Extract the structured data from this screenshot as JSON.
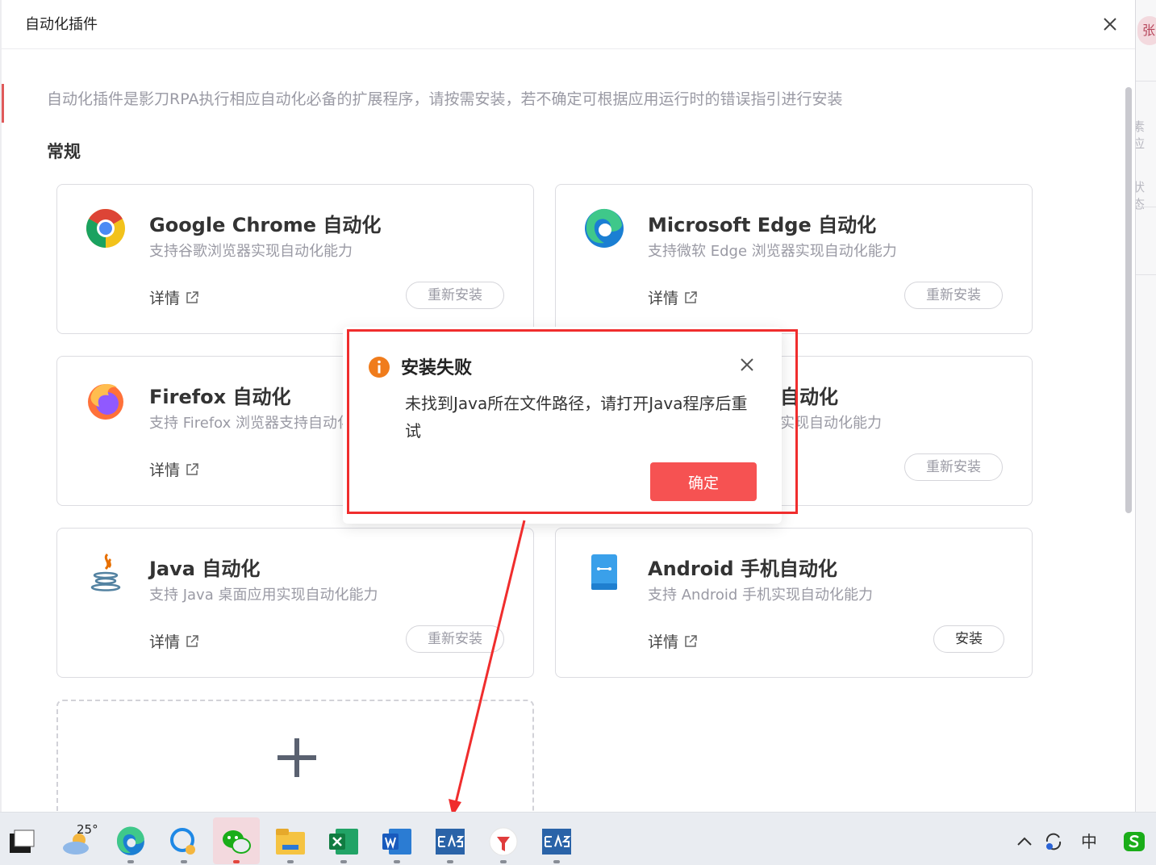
{
  "dialog": {
    "title": "自动化插件",
    "description": "自动化插件是影刀RPA执行相应自动化必备的扩展程序，请按需安装，若不确定可根据应用运行时的错误指引进行安装",
    "section": "常规"
  },
  "cards": [
    {
      "title": "Google Chrome 自动化",
      "subtitle": "支持谷歌浏览器实现自动化能力",
      "detail": "详情",
      "button": "重新安装",
      "icon": "chrome-icon"
    },
    {
      "title": "Microsoft Edge 自动化",
      "subtitle": "支持微软 Edge 浏览器实现自动化能力",
      "detail": "详情",
      "button": "重新安装",
      "icon": "edge-icon"
    },
    {
      "title": "Firefox 自动化",
      "subtitle": "支持 Firefox 浏览器支持自动化",
      "detail": "详情",
      "icon": "firefox-icon"
    },
    {
      "title": "自动化",
      "subtitle": "实现自动化能力",
      "detail": "",
      "button": "重新安装"
    },
    {
      "title": "Java 自动化",
      "subtitle": "支持 Java 桌面应用实现自动化能力",
      "detail": "详情",
      "button": "重新安装",
      "icon": "java-icon"
    },
    {
      "title": "Android 手机自动化",
      "subtitle": "支持 Android 手机实现自动化能力",
      "detail": "详情",
      "button": "安装",
      "icon": "android-phone-icon"
    }
  ],
  "modal": {
    "title": "安装失败",
    "message": "未找到Java所在文件路径，请打开Java程序后重试",
    "confirm": "确定",
    "icon": "info-warning-icon",
    "accent": "#f65252"
  },
  "background": {
    "avatar": "张",
    "fragments": [
      "素应",
      "状态"
    ]
  },
  "taskbar": {
    "temperature": "25°",
    "apps": [
      "start",
      "weather",
      "edge",
      "chat",
      "wechat",
      "file-explorer",
      "excel",
      "word",
      "eas",
      "pin-app",
      "eas"
    ],
    "tray": [
      "chevron-up",
      "sync",
      "ime-chinese",
      "sogou"
    ],
    "ime": "中"
  }
}
